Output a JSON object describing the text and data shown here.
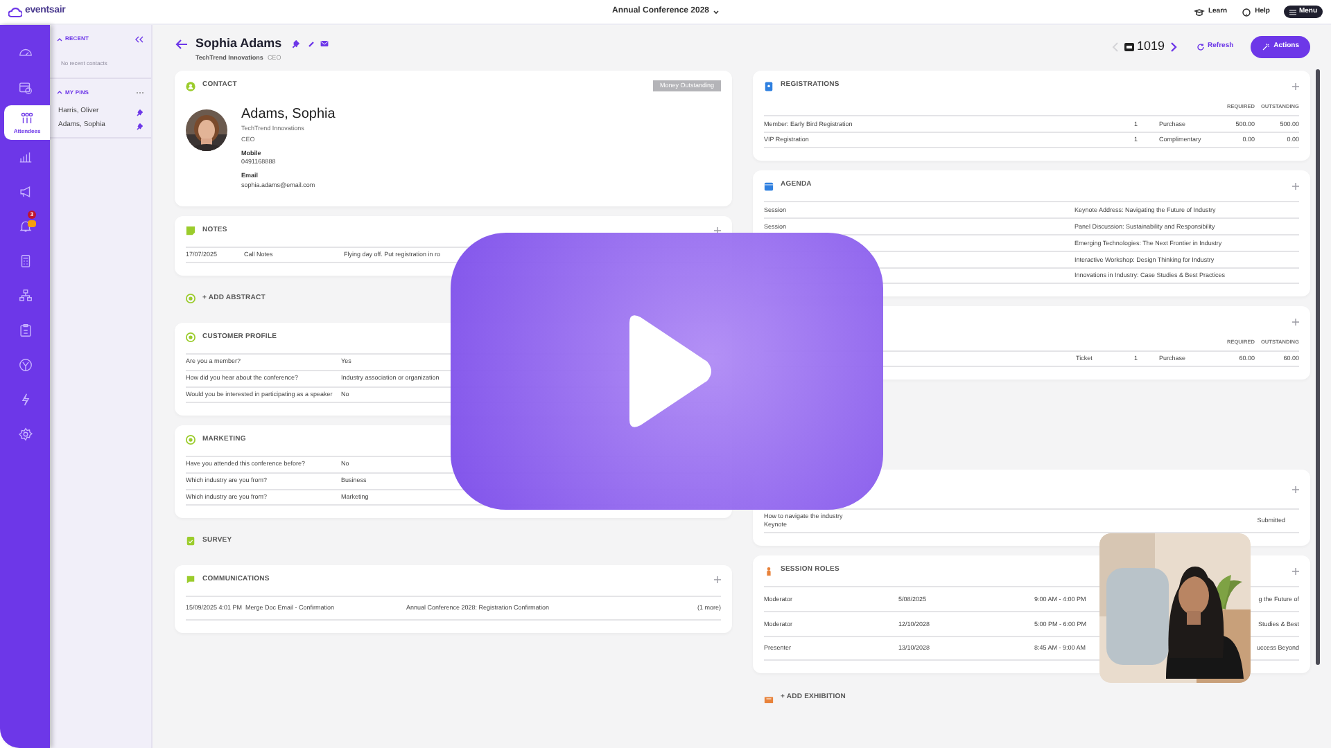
{
  "top_bar": {
    "logo": "eventsair",
    "event": "Annual Conference 2028",
    "links": [
      "Learn",
      "Help"
    ],
    "menu_button": "Menu"
  },
  "nav": [
    {
      "selected": false
    },
    {
      "selected": false
    },
    {
      "label": "Attendees",
      "selected": true
    },
    {
      "selected": false
    },
    {
      "selected": false
    },
    {
      "selected": false,
      "badge": "3"
    },
    {
      "selected": false
    },
    {
      "selected": false
    },
    {
      "selected": false
    },
    {
      "selected": false
    },
    {
      "selected": false
    },
    {
      "selected": false
    }
  ],
  "contacts_panel": {
    "recent_title": "RECENT",
    "recent_empty": "No recent contacts",
    "pins_title": "MY PINS",
    "pins": [
      "Harris, Oliver",
      "Adams, Sophia"
    ]
  },
  "header": {
    "name": "Sophia Adams",
    "company": "TechTrend Innovations",
    "role": "CEO",
    "record_id": "1019",
    "refresh": "Refresh",
    "actions": "Actions"
  },
  "left_column": [
    {
      "kind": "contact",
      "title": "CONTACT",
      "badge": "Money Outstanding",
      "name": "Adams, Sophia",
      "company": "TechTrend Innovations",
      "role": "CEO",
      "fields": [
        {
          "label": "Mobile",
          "value": "0491168888"
        },
        {
          "label": "Email",
          "value": "sophia.adams@email.com"
        }
      ]
    },
    {
      "kind": "notes",
      "title": "NOTES",
      "rows": [
        [
          "17/07/2025",
          "Call Notes",
          "Flying day off. Put registration in ro"
        ]
      ]
    },
    {
      "kind": "link",
      "label": "+ ADD ABSTRACT"
    },
    {
      "kind": "qa",
      "title": "CUSTOMER PROFILE",
      "rows": [
        [
          "Are you a member?",
          "Yes"
        ],
        [
          "How did you hear about the conference?",
          "Industry association or organization"
        ],
        [
          "Would you be interested in participating as a speaker",
          "No"
        ]
      ]
    },
    {
      "kind": "qa",
      "title": "MARKETING",
      "rows": [
        [
          "Have you attended this conference before?",
          "No"
        ],
        [
          "Which industry are you from?",
          "Business"
        ],
        [
          "Which industry are you from?",
          "Marketing"
        ]
      ]
    },
    {
      "kind": "heading",
      "title": "SURVEY"
    },
    {
      "kind": "communications",
      "title": "COMMUNICATIONS",
      "rows": [
        [
          "15/09/2025 4:01 PM",
          "Merge Doc Email - Confirmation",
          "Annual Conference 2028: Registration Confirmation",
          "(1 more)"
        ]
      ]
    }
  ],
  "right_column": [
    {
      "kind": "registrations",
      "title": "REGISTRATIONS",
      "columns": [
        "",
        "",
        "",
        "REQUIRED",
        "OUTSTANDING"
      ],
      "rows": [
        [
          "Member: Early Bird Registration",
          "1",
          "Purchase",
          "500.00",
          "500.00"
        ],
        [
          "VIP Registration",
          "1",
          "Complimentary",
          "0.00",
          "0.00"
        ]
      ]
    },
    {
      "kind": "agenda",
      "title": "AGENDA",
      "rows": [
        [
          "Session",
          "Keynote Address: Navigating the Future of Industry"
        ],
        [
          "Session",
          "Panel Discussion: Sustainability and Responsibility"
        ],
        [
          "",
          "Emerging Technologies: The Next Frontier in Industry"
        ],
        [
          "",
          "Interactive Workshop: Design Thinking for Industry"
        ],
        [
          "",
          "Innovations in Industry: Case Studies & Best Practices"
        ]
      ]
    },
    {
      "kind": "functions",
      "columns": [
        "",
        "",
        "",
        "",
        "REQUIRED",
        "OUTSTANDING"
      ],
      "rows": [
        [
          "",
          "Ticket",
          "1",
          "Purchase",
          "60.00",
          "60.00"
        ]
      ]
    },
    {
      "kind": "link"
    },
    {
      "kind": "link"
    },
    {
      "kind": "presentations",
      "rows": [
        [
          "How to navigate the industry Keynote",
          "Submitted"
        ]
      ]
    },
    {
      "kind": "session_roles",
      "title": "SESSION ROLES",
      "rows": [
        [
          "Moderator",
          "5/08/2025",
          "9:00 AM - 4:00 PM",
          "g the Future of"
        ],
        [
          "Moderator",
          "12/10/2028",
          "5:00 PM - 6:00 PM",
          "Studies & Best"
        ],
        [
          "Presenter",
          "13/10/2028",
          "8:45 AM - 9:00 AM",
          "uccess Beyond"
        ]
      ]
    },
    {
      "kind": "link",
      "label": "+ ADD EXHIBITION"
    }
  ]
}
